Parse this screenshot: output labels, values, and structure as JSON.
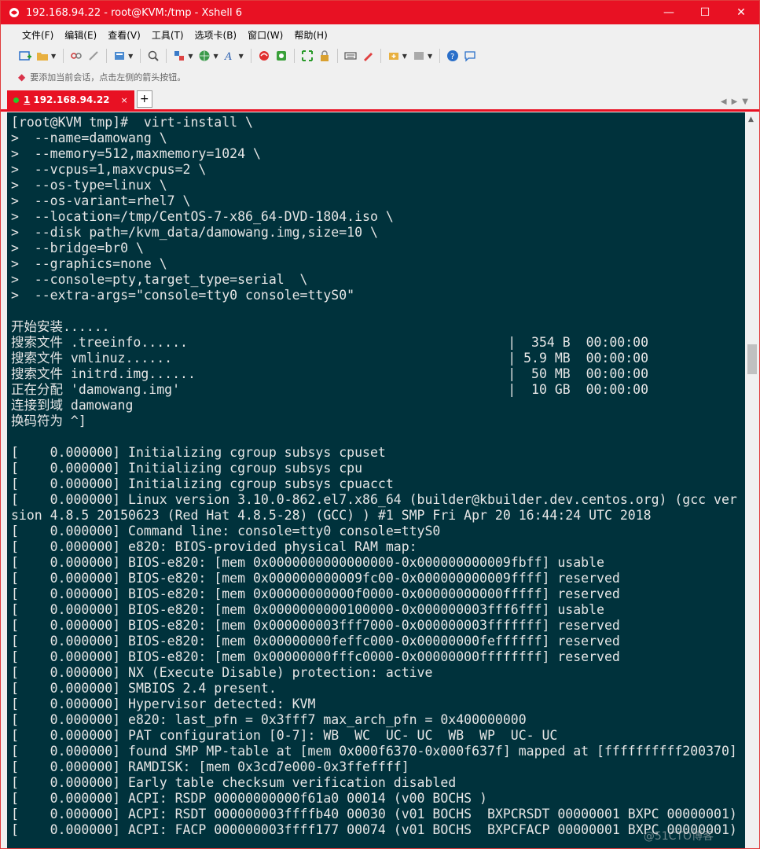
{
  "window": {
    "title": "192.168.94.22 - root@KVM:/tmp - Xshell 6",
    "controls": {
      "minimize": "—",
      "maximize": "☐",
      "close": "✕"
    }
  },
  "menu": [
    "文件(F)",
    "编辑(E)",
    "查看(V)",
    "工具(T)",
    "选项卡(B)",
    "窗口(W)",
    "帮助(H)"
  ],
  "hint": "要添加当前会话，点击左侧的箭头按钮。",
  "tab": {
    "number": "1",
    "label": "192.168.94.22",
    "close": "×",
    "add": "+"
  },
  "terminal": {
    "lines": [
      "[root@KVM tmp]#  virt-install \\",
      ">  --name=damowang \\",
      ">  --memory=512,maxmemory=1024 \\",
      ">  --vcpus=1,maxvcpus=2 \\",
      ">  --os-type=linux \\",
      ">  --os-variant=rhel7 \\",
      ">  --location=/tmp/CentOS-7-x86_64-DVD-1804.iso \\",
      ">  --disk path=/kvm_data/damowang.img,size=10 \\",
      ">  --bridge=br0 \\",
      ">  --graphics=none \\",
      ">  --console=pty,target_type=serial  \\",
      ">  --extra-args=\"console=tty0 console=ttyS0\"",
      "",
      "开始安装......",
      "搜索文件 .treeinfo......                                         |  354 B  00:00:00",
      "搜索文件 vmlinuz......                                           | 5.9 MB  00:00:00",
      "搜索文件 initrd.img......                                        |  50 MB  00:00:00",
      "正在分配 'damowang.img'                                          |  10 GB  00:00:00",
      "连接到域 damowang",
      "换码符为 ^]",
      "",
      "[    0.000000] Initializing cgroup subsys cpuset",
      "[    0.000000] Initializing cgroup subsys cpu",
      "[    0.000000] Initializing cgroup subsys cpuacct",
      "[    0.000000] Linux version 3.10.0-862.el7.x86_64 (builder@kbuilder.dev.centos.org) (gcc ver",
      "sion 4.8.5 20150623 (Red Hat 4.8.5-28) (GCC) ) #1 SMP Fri Apr 20 16:44:24 UTC 2018",
      "[    0.000000] Command line: console=tty0 console=ttyS0",
      "[    0.000000] e820: BIOS-provided physical RAM map:",
      "[    0.000000] BIOS-e820: [mem 0x0000000000000000-0x000000000009fbff] usable",
      "[    0.000000] BIOS-e820: [mem 0x000000000009fc00-0x000000000009ffff] reserved",
      "[    0.000000] BIOS-e820: [mem 0x00000000000f0000-0x00000000000fffff] reserved",
      "[    0.000000] BIOS-e820: [mem 0x0000000000100000-0x000000003fff6fff] usable",
      "[    0.000000] BIOS-e820: [mem 0x000000003fff7000-0x000000003fffffff] reserved",
      "[    0.000000] BIOS-e820: [mem 0x00000000feffc000-0x00000000feffffff] reserved",
      "[    0.000000] BIOS-e820: [mem 0x00000000fffc0000-0x00000000ffffffff] reserved",
      "[    0.000000] NX (Execute Disable) protection: active",
      "[    0.000000] SMBIOS 2.4 present.",
      "[    0.000000] Hypervisor detected: KVM",
      "[    0.000000] e820: last_pfn = 0x3fff7 max_arch_pfn = 0x400000000",
      "[    0.000000] PAT configuration [0-7]: WB  WC  UC- UC  WB  WP  UC- UC",
      "[    0.000000] found SMP MP-table at [mem 0x000f6370-0x000f637f] mapped at [ffffffffff200370]",
      "[    0.000000] RAMDISK: [mem 0x3cd7e000-0x3ffeffff]",
      "[    0.000000] Early table checksum verification disabled",
      "[    0.000000] ACPI: RSDP 00000000000f61a0 00014 (v00 BOCHS )",
      "[    0.000000] ACPI: RSDT 000000003ffffb40 00030 (v01 BOCHS  BXPCRSDT 00000001 BXPC 00000001)",
      "[    0.000000] ACPI: FACP 000000003ffff177 00074 (v01 BOCHS  BXPCFACP 00000001 BXPC 00000001)"
    ]
  },
  "watermark": "@51CTO博客",
  "colors": {
    "accent": "#e81123",
    "terminal_bg": "#00323c",
    "terminal_fg": "#e6e6e6"
  }
}
